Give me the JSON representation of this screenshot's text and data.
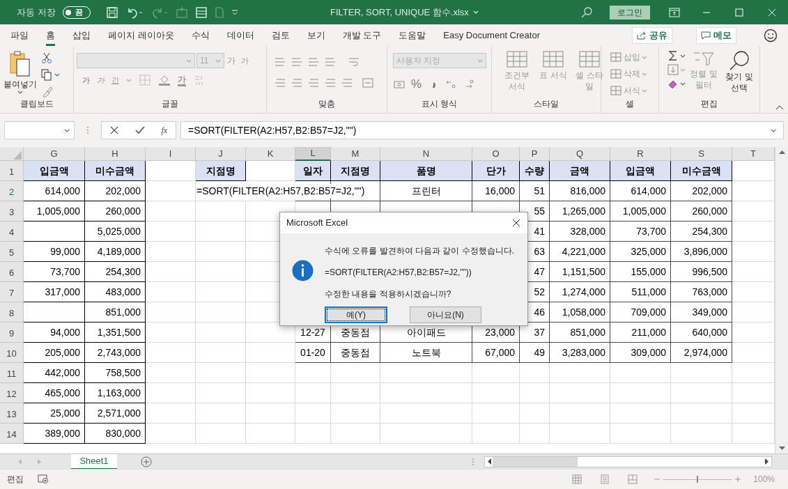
{
  "title_bar": {
    "autosave_label": "자동 저장",
    "autosave_toggle": {
      "on": false,
      "label": "끔"
    },
    "file_name": "FILTER, SORT, UNIQUE 함수.xlsx",
    "login": "로그인"
  },
  "ribbon_tabs": [
    {
      "label": "파일",
      "selected": false
    },
    {
      "label": "홈",
      "selected": true
    },
    {
      "label": "삽입",
      "selected": false
    },
    {
      "label": "페이지 레이아웃",
      "selected": false
    },
    {
      "label": "수식",
      "selected": false
    },
    {
      "label": "데이터",
      "selected": false
    },
    {
      "label": "검토",
      "selected": false
    },
    {
      "label": "보기",
      "selected": false
    },
    {
      "label": "개발 도구",
      "selected": false
    },
    {
      "label": "도움말",
      "selected": false
    },
    {
      "label": "Easy Document Creator",
      "selected": false
    }
  ],
  "share_button": "공유",
  "memo_button": "메모",
  "ribbon": {
    "groups": [
      {
        "kind": "clipboard",
        "label": "클립보드",
        "paste": "붙여넣기"
      },
      {
        "kind": "font",
        "label": "글꼴",
        "font_size": "11",
        "grow": "가",
        "shrink": "가",
        "style_buttons": [
          "가",
          "가",
          "간"
        ],
        "font_color": "가"
      },
      {
        "kind": "alignment",
        "label": "맞춤"
      },
      {
        "kind": "number",
        "label": "표시 형식",
        "format": "사용자 지정",
        "percent": "%"
      },
      {
        "kind": "styles",
        "label": "스타일",
        "buttons": [
          "조건부 서식",
          "표 서식",
          "셀 스타일"
        ]
      },
      {
        "kind": "cells",
        "label": "셀",
        "buttons": [
          "삽입",
          "삭제",
          "서식"
        ]
      },
      {
        "kind": "editing",
        "label": "편집",
        "buttons": [
          "정렬 및 필터",
          "찾기 및 선택"
        ]
      }
    ]
  },
  "formula_bar": {
    "fx": "fx",
    "formula": "=SORT(FILTER(A2:H57,B2:B57=J2,\"\")"
  },
  "columns": [
    {
      "label": "G",
      "selected": false
    },
    {
      "label": "H",
      "selected": false
    },
    {
      "label": "I",
      "selected": false
    },
    {
      "label": "J",
      "selected": false
    },
    {
      "label": "K",
      "selected": false
    },
    {
      "label": "L",
      "selected": true
    },
    {
      "label": "M",
      "selected": false
    },
    {
      "label": "N",
      "selected": false
    },
    {
      "label": "O",
      "selected": false
    },
    {
      "label": "P",
      "selected": false
    },
    {
      "label": "Q",
      "selected": false
    },
    {
      "label": "R",
      "selected": false
    },
    {
      "label": "S",
      "selected": false
    },
    {
      "label": "T",
      "selected": false
    }
  ],
  "rows": [
    {
      "number": "1",
      "selected": false,
      "kind": "header",
      "cells": {
        "g": "입금액",
        "h": "미수금액",
        "j": "지점명",
        "l": "일자",
        "m": "지점명",
        "n": "품명",
        "o": "단가",
        "p": "수량",
        "q": "금액",
        "r": "입금액",
        "s": "미수금액"
      }
    },
    {
      "number": "2",
      "selected": true,
      "kind": "data",
      "cells": {
        "g": "614,000",
        "h": "202,000",
        "j": "=SORT(FILTER(A2:H57,B2:B57=J2,\"\")",
        "n": "프린터",
        "o": "16,000",
        "p": "51",
        "q": "816,000",
        "r": "614,000",
        "s": "202,000"
      }
    },
    {
      "number": "3",
      "selected": false,
      "kind": "data",
      "cells": {
        "g": "1,005,000",
        "h": "260,000",
        "p": "55",
        "q": "1,265,000",
        "r": "1,005,000",
        "s": "260,000"
      }
    },
    {
      "number": "4",
      "selected": false,
      "kind": "data",
      "cells": {
        "h": "5,025,000",
        "p": "41",
        "q": "328,000",
        "r": "73,700",
        "s": "254,300"
      }
    },
    {
      "number": "5",
      "selected": false,
      "kind": "data",
      "cells": {
        "g": "99,000",
        "h": "4,189,000",
        "p": "63",
        "q": "4,221,000",
        "r": "325,000",
        "s": "3,896,000"
      }
    },
    {
      "number": "6",
      "selected": false,
      "kind": "data",
      "cells": {
        "g": "73,700",
        "h": "254,300",
        "p": "47",
        "q": "1,151,500",
        "r": "155,000",
        "s": "996,500"
      }
    },
    {
      "number": "7",
      "selected": false,
      "kind": "data",
      "cells": {
        "g": "317,000",
        "h": "483,000",
        "p": "52",
        "q": "1,274,000",
        "r": "511,000",
        "s": "763,000"
      }
    },
    {
      "number": "8",
      "selected": false,
      "kind": "data",
      "cells": {
        "h": "851,000",
        "p": "46",
        "q": "1,058,000",
        "r": "709,000",
        "s": "349,000"
      }
    },
    {
      "number": "9",
      "selected": false,
      "kind": "data",
      "cells": {
        "g": "94,000",
        "h": "1,351,500",
        "l": "12-27",
        "m": "중동점",
        "n": "아이패드",
        "o": "23,000",
        "p": "37",
        "q": "851,000",
        "r": "211,000",
        "s": "640,000"
      }
    },
    {
      "number": "10",
      "selected": false,
      "kind": "data",
      "cells": {
        "g": "205,000",
        "h": "2,743,000",
        "l": "01-20",
        "m": "중동점",
        "n": "노트북",
        "o": "67,000",
        "p": "49",
        "q": "3,283,000",
        "r": "309,000",
        "s": "2,974,000"
      }
    },
    {
      "number": "11",
      "selected": false,
      "kind": "data",
      "cells": {
        "g": "442,000",
        "h": "758,500"
      }
    },
    {
      "number": "12",
      "selected": false,
      "kind": "data",
      "cells": {
        "g": "465,000",
        "h": "1,163,000"
      }
    },
    {
      "number": "13",
      "selected": false,
      "kind": "data",
      "cells": {
        "g": "25,000",
        "h": "2,571,000"
      }
    },
    {
      "number": "14",
      "selected": false,
      "kind": "data",
      "cells": {
        "g": "389,000",
        "h": "830,000"
      }
    }
  ],
  "dialog": {
    "title": "Microsoft Excel",
    "message": "수식에 오류를 발견하여 다음과 같이 수정했습니다.",
    "corrected_formula": "=SORT(FILTER(A2:H57,B2:B57=J2,\"\"))",
    "question": "수정한 내용을 적용하시겠습니까?",
    "buttons": [
      {
        "label": "예(Y)",
        "selected": true
      },
      {
        "label": "아니요(N)",
        "selected": false
      }
    ]
  },
  "sheet_tabs": [
    {
      "label": "Sheet1",
      "selected": true
    }
  ],
  "status_bar": {
    "mode": "편집",
    "zoom_slider": {
      "level": 0.5
    },
    "zoom": "100%"
  }
}
